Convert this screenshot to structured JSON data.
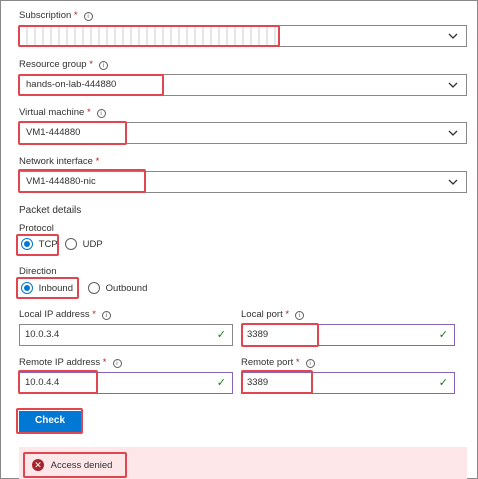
{
  "subscription": {
    "label": "Subscription",
    "required": "*",
    "info": "i",
    "value": ""
  },
  "resource_group": {
    "label": "Resource group",
    "required": "*",
    "info": "i",
    "value": "hands-on-lab-444880"
  },
  "virtual_machine": {
    "label": "Virtual machine",
    "required": "*",
    "info": "i",
    "value": "VM1-444880"
  },
  "network_interface": {
    "label": "Network interface",
    "required": "*",
    "value": "VM1-444880-nic"
  },
  "packet_details": {
    "heading": "Packet details"
  },
  "protocol": {
    "label": "Protocol",
    "options": [
      "TCP",
      "UDP"
    ],
    "selected": "TCP"
  },
  "direction": {
    "label": "Direction",
    "options": [
      "Inbound",
      "Outbound"
    ],
    "selected": "Inbound"
  },
  "local_ip": {
    "label": "Local IP address",
    "required": "*",
    "info": "i",
    "value": "10.0.3.4"
  },
  "local_port": {
    "label": "Local port",
    "required": "*",
    "info": "i",
    "value": "3389"
  },
  "remote_ip": {
    "label": "Remote IP address",
    "required": "*",
    "info": "i",
    "value": "10.0.4.4"
  },
  "remote_port": {
    "label": "Remote port",
    "required": "*",
    "info": "i",
    "value": "3389"
  },
  "check_button": {
    "label": "Check"
  },
  "result": {
    "status_icon": "error-icon",
    "icon_glyph": "✕",
    "text": "Access denied"
  },
  "colors": {
    "accent": "#0078d4",
    "highlight": "#e0464f",
    "valid": "#107c10",
    "error_bg": "#fde7e9"
  },
  "icons": {
    "dropdown": "chevron-down-icon",
    "info": "info-icon",
    "valid": "checkmark-icon"
  }
}
